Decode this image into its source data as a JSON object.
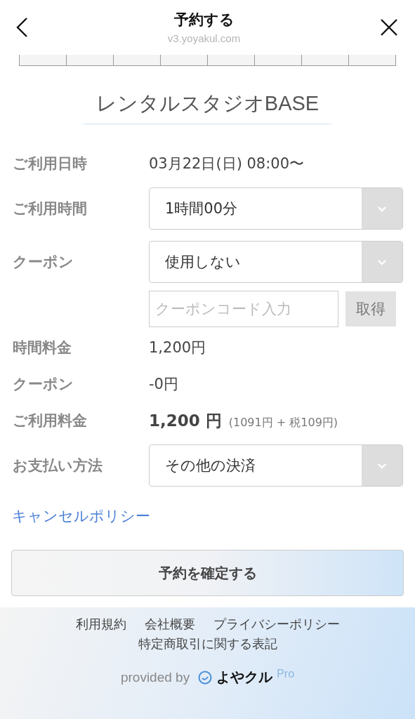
{
  "header": {
    "title": "予約する",
    "url": "v3.yoyakul.com"
  },
  "studio_name": "レンタルスタジオBASE",
  "rows": [
    {
      "kind": "text",
      "label": "ご利用日時",
      "value": "03月22日(日) 08:00〜"
    },
    {
      "kind": "select",
      "label": "ご利用時間",
      "value": "1時間00分"
    },
    {
      "kind": "select",
      "label": "クーポン",
      "value": "使用しない"
    },
    {
      "kind": "code",
      "placeholder": "クーポンコード入力",
      "button": "取得",
      "disabled": true
    },
    {
      "kind": "text",
      "label": "時間料金",
      "value": "1,200円"
    },
    {
      "kind": "text",
      "label": "クーポン",
      "value": "-0円"
    },
    {
      "kind": "total",
      "label": "ご利用料金",
      "value": "1,200 円",
      "detail": "(1091円 + 税109円)"
    },
    {
      "kind": "select",
      "label": "お支払い方法",
      "value": "その他の決済"
    }
  ],
  "cancel_policy_link": "キャンセルポリシー",
  "confirm_button": "予約を確定する",
  "footer": {
    "links": [
      "利用規約",
      "会社概要",
      "プライバシーポリシー",
      "特定商取引に関する表記"
    ],
    "provided_by": "provided by",
    "logo": "よやクル",
    "logo_suffix": "Pro"
  }
}
